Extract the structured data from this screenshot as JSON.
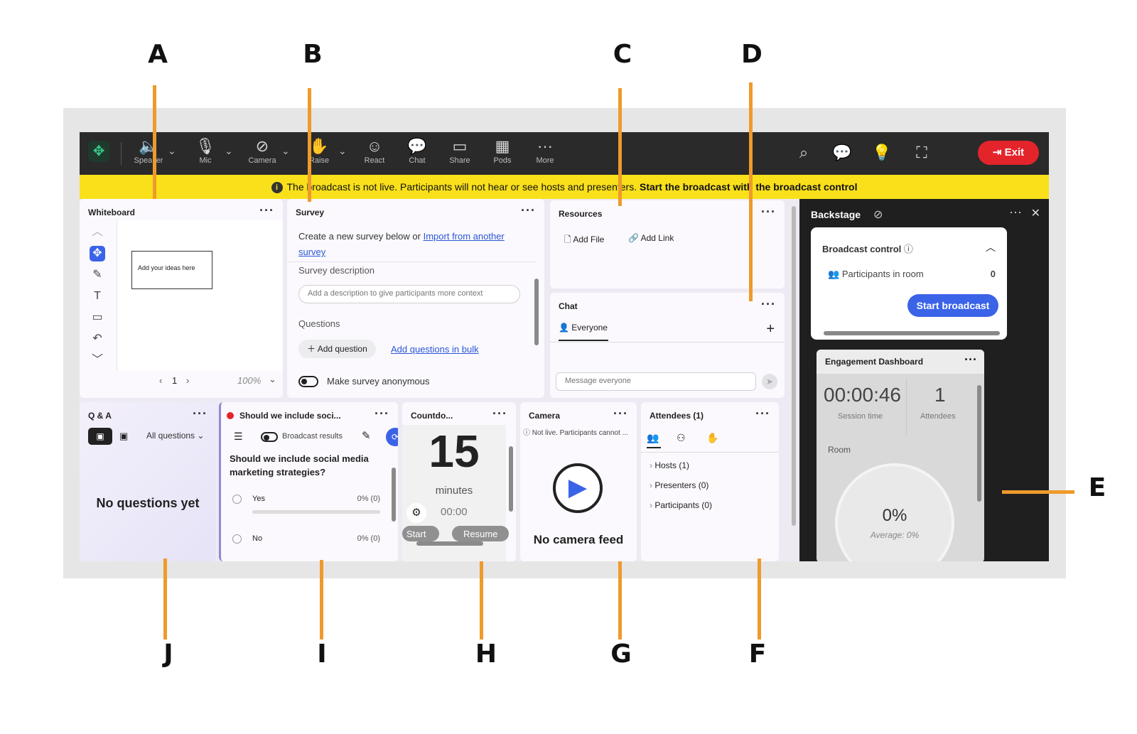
{
  "callouts": [
    "A",
    "B",
    "C",
    "D",
    "E",
    "F",
    "G",
    "H",
    "I",
    "J"
  ],
  "toolbar": {
    "speaker": "Speaker",
    "mic": "Mic",
    "camera": "Camera",
    "raise": "Raise",
    "react": "React",
    "chat": "Chat",
    "share": "Share",
    "pods": "Pods",
    "more": "More",
    "exit": "Exit"
  },
  "banner": {
    "text": "The broadcast is not live. Participants will not hear or see hosts and presenters.",
    "bold": "Start the broadcast with the broadcast control"
  },
  "whiteboard": {
    "title": "Whiteboard",
    "note": "Add your ideas here",
    "page": "1",
    "zoom": "100%"
  },
  "survey": {
    "title": "Survey",
    "intro": "Create a new survey below or",
    "import_link": "Import from another survey",
    "desc_label": "Survey description",
    "desc_placeholder": "Add a description to give participants more context",
    "questions_label": "Questions",
    "add_question": "Add question",
    "add_bulk": "Add questions in bulk",
    "anonymous": "Make survey anonymous"
  },
  "resources": {
    "title": "Resources",
    "add_file": "Add File",
    "add_link": "Add Link"
  },
  "chat": {
    "title": "Chat",
    "tab": "Everyone",
    "placeholder": "Message everyone"
  },
  "backstage": {
    "title": "Backstage",
    "broadcast_control": "Broadcast control",
    "participants_label": "Participants in room",
    "participants_count": "0",
    "start_broadcast": "Start broadcast"
  },
  "engagement": {
    "title": "Engagement Dashboard",
    "session_time": "00:00:46",
    "session_label": "Session time",
    "attendees": "1",
    "attendees_label": "Attendees",
    "room_label": "Room",
    "percent": "0%",
    "average": "Average: 0%"
  },
  "qa": {
    "title": "Q & A",
    "filter": "All questions",
    "empty": "No questions yet"
  },
  "poll": {
    "title": "Should we include soci...",
    "broadcast": "Broadcast results",
    "question": "Should we include social media marketing strategies?",
    "options": [
      {
        "label": "Yes",
        "result": "0% (0)"
      },
      {
        "label": "No",
        "result": "0% (0)"
      }
    ]
  },
  "countdown": {
    "title": "Countdo...",
    "value": "15",
    "unit": "minutes",
    "time": "00:00",
    "start": "Start",
    "resume": "Resume"
  },
  "camera": {
    "title": "Camera",
    "notice": "Not live. Participants cannot ...",
    "empty": "No camera feed"
  },
  "attendees": {
    "title": "Attendees (1)",
    "groups": [
      "Hosts (1)",
      "Presenters (0)",
      "Participants (0)"
    ]
  }
}
